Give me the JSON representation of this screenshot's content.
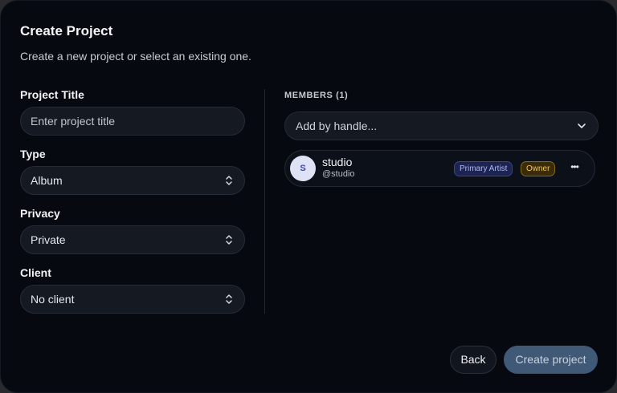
{
  "dialog": {
    "title": "Create Project",
    "subtitle": "Create a new project or select an existing one."
  },
  "form": {
    "title_label": "Project Title",
    "title_placeholder": "Enter project title",
    "type_label": "Type",
    "type_value": "Album",
    "privacy_label": "Privacy",
    "privacy_value": "Private",
    "client_label": "Client",
    "client_value": "No client"
  },
  "members": {
    "heading": "MEMBERS (1)",
    "add_placeholder": "Add by handle...",
    "list": [
      {
        "initial": "S",
        "name": "studio",
        "handle": "@studio",
        "role": "Primary Artist",
        "permission": "Owner",
        "more": "•••"
      }
    ]
  },
  "actions": {
    "back_label": "Back",
    "create_label": "Create project"
  },
  "colors": {
    "background": "#060910",
    "control_bg": "#141922",
    "primary_button": "#405977",
    "role_badge": "#1d2452",
    "owner_badge": "#3a2c08"
  }
}
